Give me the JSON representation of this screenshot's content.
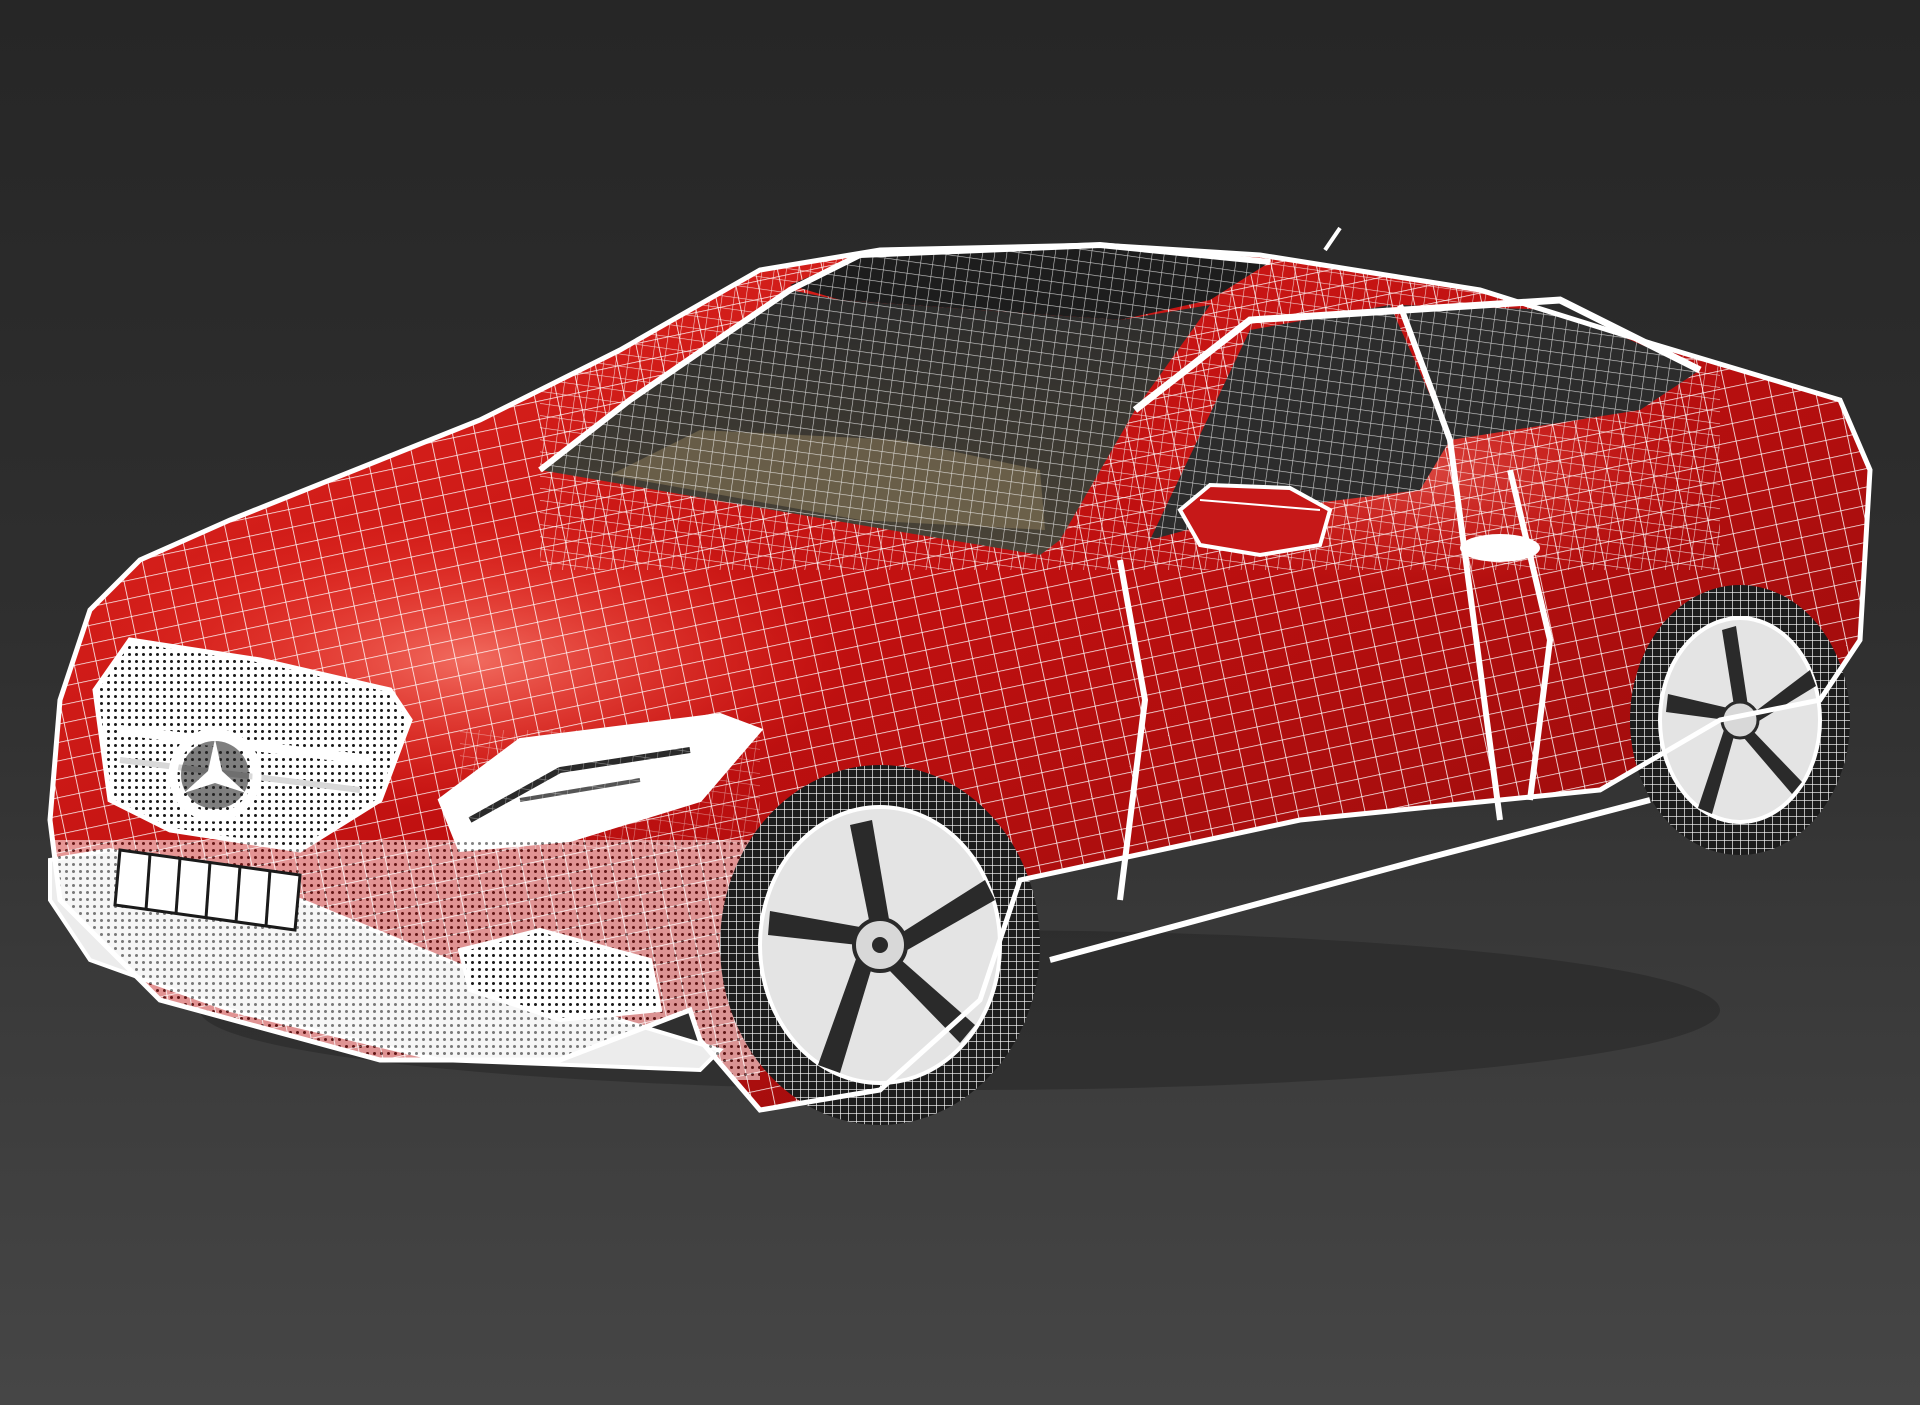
{
  "viewport": {
    "background_top": "#262626",
    "background_bottom": "#464646",
    "display_mode": "shaded-with-edged-faces"
  },
  "model": {
    "subject": "coupe-car-wireframe",
    "body_color": "#d41414",
    "body_highlight": "#ff3a2a",
    "body_shadow": "#7a0808",
    "wire_color": "#ffffff",
    "glass_color": "#3a3a3a",
    "interior_color": "#8a7a5a",
    "wheel_color": "#e6e6e6",
    "badge_icon": "three-pointed-star-icon"
  }
}
